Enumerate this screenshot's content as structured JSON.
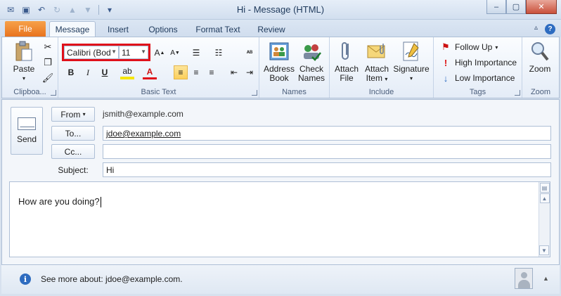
{
  "window": {
    "title": "Hi  -  Message (HTML)"
  },
  "qat": {
    "icons": [
      "outlook-icon",
      "save-icon",
      "undo-icon",
      "redo-icon",
      "up-icon",
      "down-icon",
      "customize-icon"
    ]
  },
  "tabs": {
    "file": "File",
    "items": [
      "Message",
      "Insert",
      "Options",
      "Format Text",
      "Review"
    ],
    "active": "Message"
  },
  "ribbon": {
    "clipboard": {
      "label": "Clipboa...",
      "paste": "Paste"
    },
    "basic_text": {
      "label": "Basic Text",
      "font_name": "Calibri (Bod",
      "font_size": "11",
      "bold": "B",
      "italic": "I",
      "underline": "U"
    },
    "names": {
      "label": "Names",
      "address_book": [
        "Address",
        "Book"
      ],
      "check_names": [
        "Check",
        "Names"
      ]
    },
    "include": {
      "label": "Include",
      "attach_file": [
        "Attach",
        "File"
      ],
      "attach_item": [
        "Attach",
        "Item"
      ],
      "signature": "Signature"
    },
    "tags": {
      "label": "Tags",
      "follow_up": "Follow Up",
      "high": "High Importance",
      "low": "Low Importance"
    },
    "zoom": {
      "label": "Zoom",
      "zoom": "Zoom"
    }
  },
  "compose": {
    "send": "Send",
    "from_button": "From",
    "from_value": "jsmith@example.com",
    "to_button": "To...",
    "to_value": "jdoe@example.com",
    "cc_button": "Cc...",
    "cc_value": "",
    "subject_label": "Subject:",
    "subject_value": "Hi",
    "body_text": "How are you doing?"
  },
  "status": {
    "see_more": "See more about: jdoe@example.com."
  },
  "colors": {
    "file_tab": "#e8731e",
    "highlight_box": "#e0101a",
    "accent": "#2e6cc0"
  }
}
